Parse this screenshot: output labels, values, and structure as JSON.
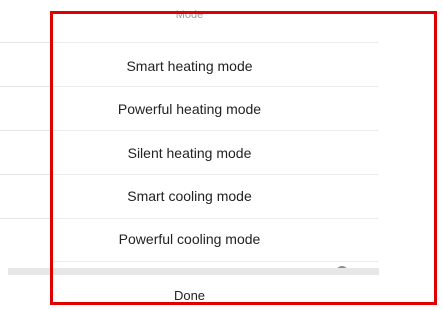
{
  "sheet": {
    "title": "Mode",
    "options": [
      {
        "label": "Smart heating mode"
      },
      {
        "label": "Powerful heating mode"
      },
      {
        "label": "Silent heating mode"
      },
      {
        "label": "Smart cooling mode"
      },
      {
        "label": "Powerful cooling mode"
      }
    ],
    "done_label": "Done"
  },
  "colors": {
    "highlight": "#e00000",
    "divider": "#ececec",
    "title_text": "#9a9a9a",
    "option_text": "#222222"
  }
}
